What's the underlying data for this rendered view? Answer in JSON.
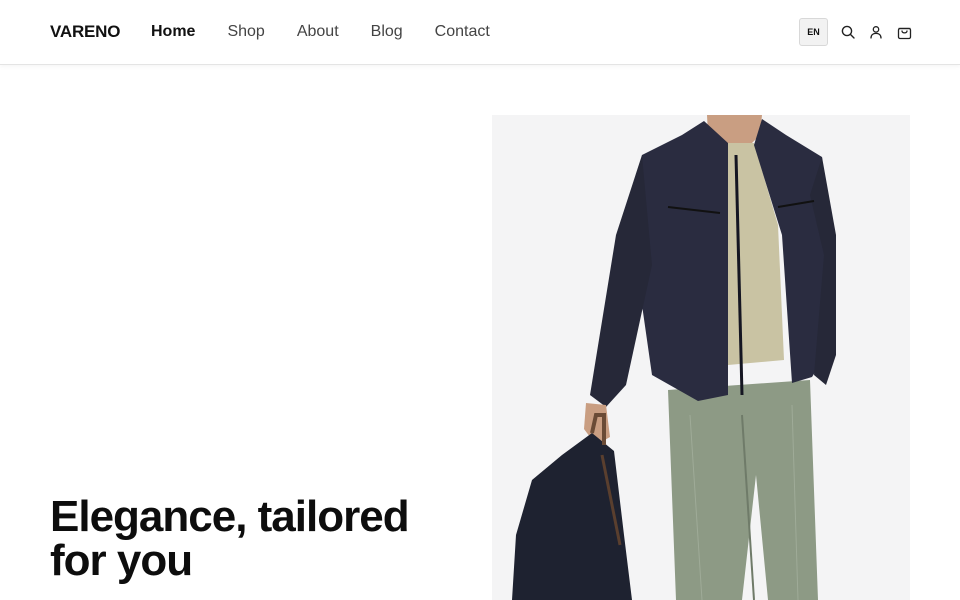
{
  "header": {
    "logo": "VARENO",
    "nav": [
      {
        "label": "Home",
        "active": true
      },
      {
        "label": "Shop",
        "active": false
      },
      {
        "label": "About",
        "active": false
      },
      {
        "label": "Blog",
        "active": false
      },
      {
        "label": "Contact",
        "active": false
      }
    ],
    "language": "EN",
    "icons": [
      "search-icon",
      "user-icon",
      "shopping-bag-icon"
    ]
  },
  "hero": {
    "title_line1": "Elegance, tailored",
    "title_line2": "for you"
  },
  "colors": {
    "text": "#111111",
    "nav_inactive": "#444444",
    "image_bg": "#f4f4f5",
    "jacket": "#2a2c40",
    "pants": "#8d9a85",
    "shirt": "#c9c3a3"
  }
}
